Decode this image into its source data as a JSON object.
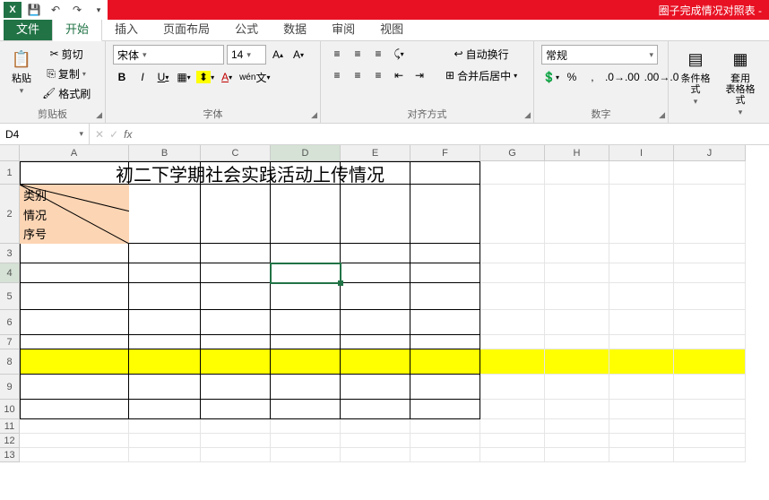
{
  "titlebar": {
    "title": "圈子完成情况对照表 -"
  },
  "tabs": {
    "file": "文件",
    "home": "开始",
    "insert": "插入",
    "layout": "页面布局",
    "formulas": "公式",
    "data": "数据",
    "review": "审阅",
    "view": "视图"
  },
  "ribbon": {
    "clipboard": {
      "paste": "粘贴",
      "cut": "剪切",
      "copy": "复制",
      "format_painter": "格式刷",
      "label": "剪贴板"
    },
    "font": {
      "name": "宋体",
      "size": "14",
      "label": "字体"
    },
    "align": {
      "wrap": "自动换行",
      "merge": "合并后居中",
      "label": "对齐方式"
    },
    "number": {
      "format": "常规",
      "label": "数字"
    },
    "styles": {
      "cond": "条件格式",
      "table": "套用\n表格格式"
    }
  },
  "namebox": "D4",
  "sheet": {
    "columns": [
      "A",
      "B",
      "C",
      "D",
      "E",
      "F",
      "G",
      "H",
      "I",
      "J"
    ],
    "row1_title": "初二下学期社会实践活动上传情况",
    "cell_a2_lines": [
      "类别",
      "情况",
      "序号"
    ]
  },
  "chart_data": {
    "type": "table",
    "title": "初二下学期社会实践活动上传情况",
    "column_headers_diagonal": [
      "类别",
      "情况",
      "序号"
    ],
    "bordered_range": "A1:F10",
    "highlighted_row": 8,
    "selected_cell": "D4",
    "rows": []
  }
}
